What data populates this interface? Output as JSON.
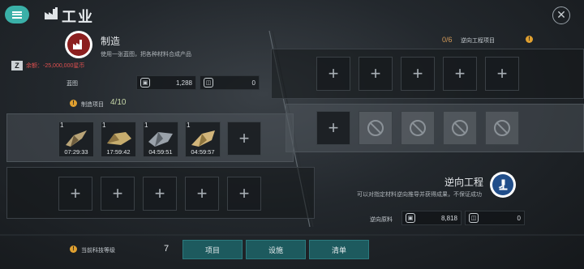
{
  "header": {
    "title": "工业"
  },
  "manufacturing": {
    "title": "制造",
    "description": "使用一张蓝图，把各种材料合成产品",
    "corp_badge": "Z",
    "balance": "余额：-25,000,000星币",
    "blueprint_label": "蓝图",
    "blueprint_value": "1,288",
    "blueprint_value2": "0",
    "project_label": "制造项目",
    "project_count": "4/10",
    "items": [
      {
        "qty": "1",
        "time": "07:29:33"
      },
      {
        "qty": "1",
        "time": "17:59:42"
      },
      {
        "qty": "1",
        "time": "04:59:51"
      },
      {
        "qty": "1",
        "time": "04:59:57"
      }
    ]
  },
  "reverse": {
    "project_count": "0/6",
    "project_label": "逆向工程项目",
    "title": "逆向工程",
    "description": "可以对指定材料逆向推导并获得成果，不保证成功",
    "material_label": "逆向原料",
    "material_value": "8,818",
    "material_value2": "0"
  },
  "footer": {
    "tech_label": "当前科技等级",
    "tech_level": "7",
    "tabs": [
      "项目",
      "设施",
      "清单"
    ]
  },
  "colors": {
    "accent": "#3ab0a8",
    "tab": "#1d5a5e",
    "warning": "#e0a030",
    "negative": "#e05050"
  }
}
